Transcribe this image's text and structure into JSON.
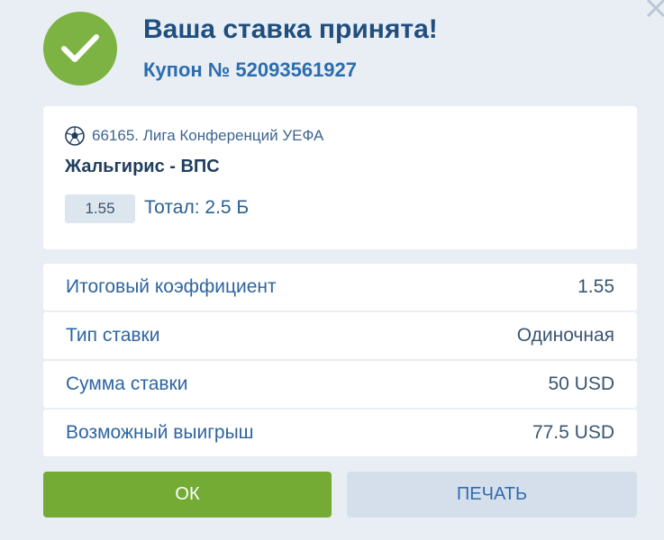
{
  "dialog": {
    "title": "Ваша ставка принята!",
    "coupon": "Купон № 52093561927",
    "close_icon": "close-icon",
    "status_icon": "check-icon",
    "accent_color": "#7cb342"
  },
  "event": {
    "sport_icon": "soccer-ball-icon",
    "league": "66165. Лига Конференций УЕФА",
    "match": "Жальгирис - ВПС",
    "odds": "1.55",
    "bet": "Тотал: 2.5 Б"
  },
  "summary": [
    {
      "label": "Итоговый коэффициент",
      "value": "1.55"
    },
    {
      "label": "Тип ставки",
      "value": "Одиночная"
    },
    {
      "label": "Сумма ставки",
      "value": "50 USD"
    },
    {
      "label": "Возможный выигрыш",
      "value": "77.5 USD"
    }
  ],
  "buttons": {
    "ok": "ОК",
    "print": "ПЕЧАТЬ"
  }
}
